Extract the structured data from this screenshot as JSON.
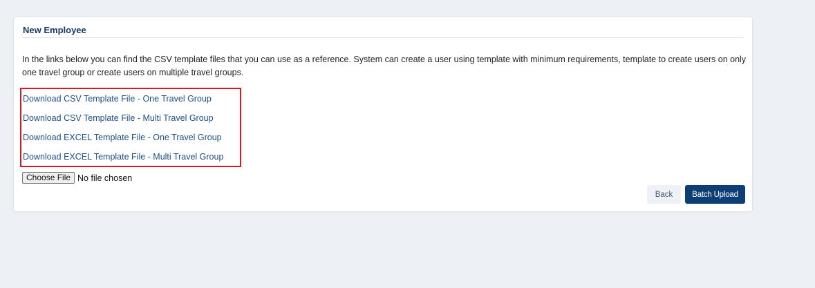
{
  "card": {
    "title": "New Employee",
    "intro": "In the links below you can find the CSV template files that you can use as a reference. System can create a user using template with minimum requirements, template to create users on only one travel group or create users on multiple travel groups."
  },
  "links": [
    "Download CSV Template File - One Travel Group",
    "Download CSV Template File - Multi Travel Group",
    "Download EXCEL Template File - One Travel Group",
    "Download EXCEL Template File - Multi Travel Group"
  ],
  "file_input": {
    "button_label": "Choose File",
    "status": "No file chosen"
  },
  "actions": {
    "back_label": "Back",
    "batch_upload_label": "Batch Upload"
  },
  "colors": {
    "link": "#1d4f85",
    "primary_button": "#0e3e76",
    "highlight_border": "#e0151f",
    "title": "#163a66"
  }
}
